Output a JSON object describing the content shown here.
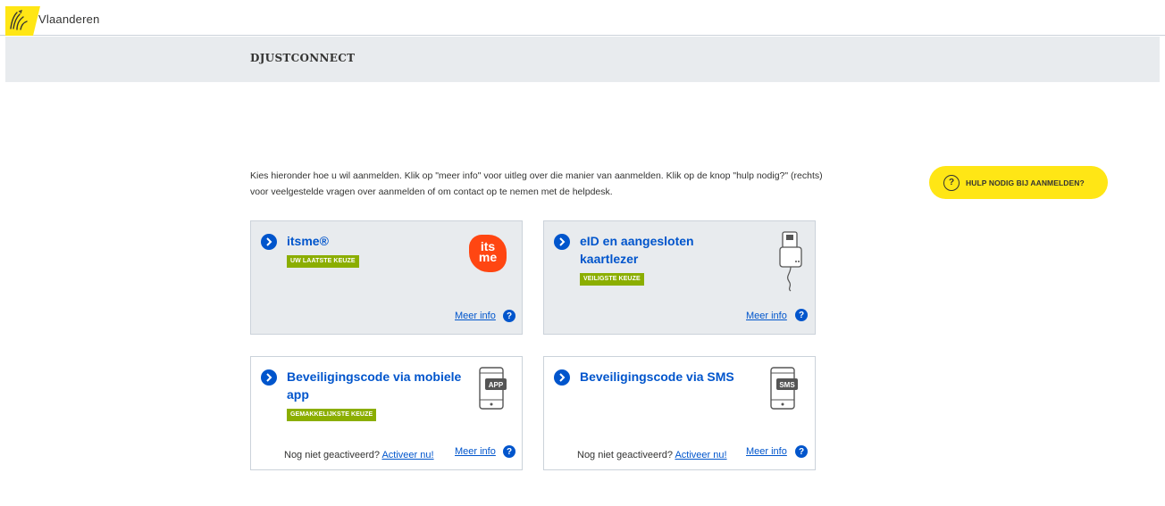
{
  "topbar": {
    "brand": "Vlaanderen"
  },
  "header": {
    "title": "DJUSTCONNECT"
  },
  "intro": "Kies hieronder hoe u wil aanmelden. Klik op \"meer info\" voor uitleg over die manier van aanmelden. Klik op de knop \"hulp nodig?\" (rechts) voor veelgestelde vragen over aanmelden of om contact op te nemen met de helpdesk.",
  "help_button": {
    "label": "HULP NODIG BIJ AANMELDEN?"
  },
  "cards": [
    {
      "title": "itsme®",
      "badge": "UW LAATSTE KEUZE",
      "meer": "Meer info",
      "icon": "itsme-logo",
      "logo_text": "its me"
    },
    {
      "title": "eID en aangesloten kaartlezer",
      "badge": "VEILIGSTE KEUZE",
      "meer": "Meer info",
      "icon": "card-reader-icon"
    },
    {
      "title": "Beveiligingscode via mobiele app",
      "badge": "GEMAKKELIJKSTE KEUZE",
      "meer": "Meer info",
      "note": "Nog niet geactiveerd?",
      "activate": "Activeer nu!",
      "icon": "phone-app-icon",
      "icon_label": "APP"
    },
    {
      "title": "Beveiligingscode via SMS",
      "meer": "Meer info",
      "note": "Nog niet geactiveerd?",
      "activate": "Activeer nu!",
      "icon": "phone-sms-icon",
      "icon_label": "SMS"
    }
  ],
  "colors": {
    "brand_yellow": "#ffe615",
    "link_blue": "#0055cc",
    "badge_green": "#8bae00",
    "itsme_orange": "#ff4612",
    "panel_grey": "#e8ebee"
  }
}
